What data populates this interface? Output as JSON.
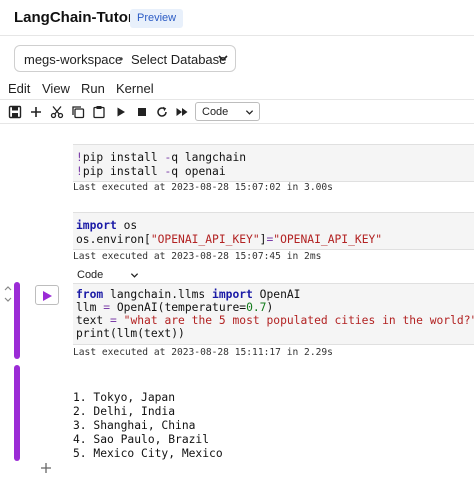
{
  "header": {
    "app_title": "LangChain-Tutorial",
    "badge": "Preview"
  },
  "workspace_bar": {
    "workspace": "megs-workspace",
    "separator": "•",
    "database": "Select Database",
    "icon": "chevron-down-icon"
  },
  "menu": {
    "items": [
      "Edit",
      "View",
      "Run",
      "Kernel"
    ]
  },
  "toolbar": {
    "icons": [
      "save-icon",
      "add-cell-icon",
      "cut-icon",
      "copy-icon",
      "paste-icon",
      "run-icon",
      "stop-icon",
      "restart-icon",
      "fast-forward-icon"
    ],
    "cell_type": "Code"
  },
  "cells": [
    {
      "lines": [
        "!pip install -q langchain",
        "!pip install -q openai"
      ],
      "executed": "Last executed at 2023-08-28 15:07:02 in 3.00s"
    },
    {
      "lines": [
        "import os",
        "os.environ[\"OPENAI_API_KEY\"]=\"OPENAI_API_KEY\""
      ],
      "executed": "Last executed at 2023-08-28 15:07:45 in 2ms"
    },
    {
      "cell_type": "Code",
      "lines": [
        "from langchain.llms import OpenAI",
        "llm = OpenAI(temperature=0.7)",
        "text = \"what are the 5 most populated cities in the world?\"",
        "print(llm(text))"
      ],
      "executed": "Last executed at 2023-08-28 15:11:17 in 2.29s"
    }
  ],
  "output": {
    "lines": [
      "1. Tokyo, Japan",
      "2. Delhi, India",
      "3. Shanghai, China",
      "4. Sao Paulo, Brazil",
      "5. Mexico City, Mexico"
    ]
  },
  "colors": {
    "active_cell": "#9b2bd6",
    "keyword": "#1a1aa6",
    "string": "#b22222",
    "number": "#117a1a",
    "badge_bg": "#e8f0fb"
  }
}
